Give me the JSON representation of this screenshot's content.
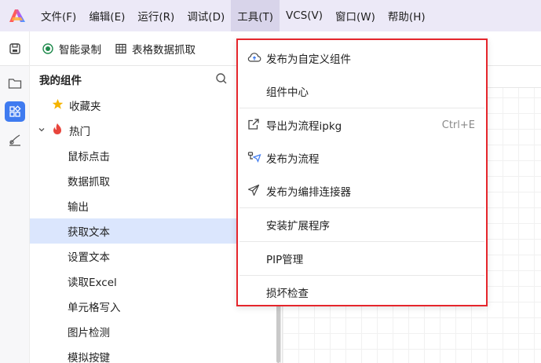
{
  "menubar": {
    "items": [
      {
        "label": "文件(F)"
      },
      {
        "label": "编辑(E)"
      },
      {
        "label": "运行(R)"
      },
      {
        "label": "调试(D)"
      },
      {
        "label": "工具(T)"
      },
      {
        "label": "VCS(V)"
      },
      {
        "label": "窗口(W)"
      },
      {
        "label": "帮助(H)"
      }
    ],
    "active_index": 4
  },
  "toolbar": {
    "record_label": "智能录制",
    "table_capture_label": "表格数据抓取"
  },
  "panel": {
    "title": "我的组件",
    "favorites_label": "收藏夹",
    "hot_label": "热门",
    "items": [
      "鼠标点击",
      "数据抓取",
      "输出",
      "获取文本",
      "设置文本",
      "读取Excel",
      "单元格写入",
      "图片检测",
      "模拟按键"
    ],
    "selected_item": "获取文本"
  },
  "dropdown": {
    "items": [
      {
        "label": "发布为自定义组件",
        "icon": "cloud-upload-icon",
        "shortcut": ""
      },
      {
        "label": "组件中心",
        "icon": "",
        "shortcut": ""
      },
      {
        "label": "导出为流程ipkg",
        "icon": "export-icon",
        "shortcut": "Ctrl+E"
      },
      {
        "label": "发布为流程",
        "icon": "flow-publish-icon",
        "shortcut": ""
      },
      {
        "label": "发布为编排连接器",
        "icon": "send-icon",
        "shortcut": ""
      },
      {
        "label": "安装扩展程序",
        "icon": "",
        "shortcut": ""
      },
      {
        "label": "PIP管理",
        "icon": "",
        "shortcut": ""
      },
      {
        "label": "损坏检查",
        "icon": "",
        "shortcut": ""
      }
    ]
  },
  "colors": {
    "menubar_bg": "#ece9f7",
    "accent_blue": "#3f7bf0",
    "selected_row": "#dbe6fd",
    "highlight_border": "#e5262c",
    "favorite_star": "#f5b400",
    "hot_flame": "#e8453c"
  }
}
